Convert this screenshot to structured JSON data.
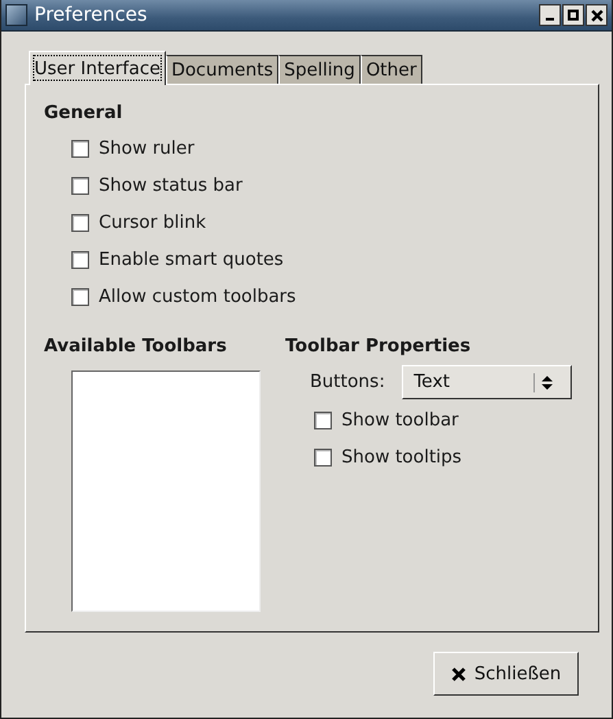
{
  "window": {
    "title": "Preferences"
  },
  "tabs": [
    {
      "label": "User Interface",
      "selected": true
    },
    {
      "label": "Documents",
      "selected": false
    },
    {
      "label": "Spelling",
      "selected": false
    },
    {
      "label": "Other",
      "selected": false
    }
  ],
  "general": {
    "heading": "General",
    "options": [
      {
        "label": "Show ruler",
        "checked": false
      },
      {
        "label": "Show status bar",
        "checked": false
      },
      {
        "label": "Cursor blink",
        "checked": false
      },
      {
        "label": "Enable smart quotes",
        "checked": false
      },
      {
        "label": "Allow custom toolbars",
        "checked": false
      }
    ]
  },
  "available_toolbars": {
    "heading": "Available Toolbars"
  },
  "toolbar_properties": {
    "heading": "Toolbar Properties",
    "buttons_label": "Buttons:",
    "buttons_value": "Text",
    "options": [
      {
        "label": "Show toolbar",
        "checked": false
      },
      {
        "label": "Show tooltips",
        "checked": false
      }
    ]
  },
  "close_button": {
    "label": "Schließen"
  }
}
